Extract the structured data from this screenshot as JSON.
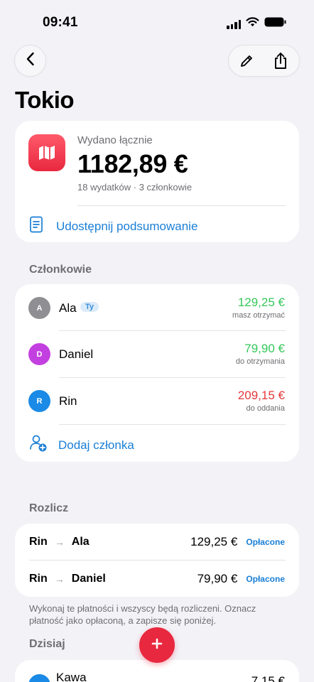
{
  "status_bar": {
    "time": "09:41"
  },
  "header": {
    "title": "Tokio"
  },
  "summary": {
    "label": "Wydano łącznie",
    "total": "1182,89 €",
    "meta": "18 wydatków · 3 członkowie",
    "share_label": "Udostępnij podsumowanie",
    "accent_color": "#e8283f"
  },
  "members": {
    "section_title": "Członkowie",
    "items": [
      {
        "initial": "A",
        "name": "Ala",
        "badge": "Ty",
        "amount": "129,25 €",
        "note": "masz otrzymać",
        "amount_color": "#34c759",
        "avatar_color": "#8e8e93"
      },
      {
        "initial": "D",
        "name": "Daniel",
        "amount": "79,90 €",
        "note": "do otrzymania",
        "amount_color": "#34c759",
        "avatar_color": "#c340e0"
      },
      {
        "initial": "R",
        "name": "Rin",
        "amount": "209,15 €",
        "note": "do oddania",
        "amount_color": "#e5383b",
        "avatar_color": "#1a8ae6"
      }
    ],
    "add_label": "Dodaj członka"
  },
  "settle": {
    "section_title": "Rozlicz",
    "items": [
      {
        "from": "Rin",
        "to": "Ala",
        "amount": "129,25 €",
        "action": "Opłacone"
      },
      {
        "from": "Rin",
        "to": "Daniel",
        "amount": "79,90 €",
        "action": "Opłacone"
      }
    ],
    "hint": "Wykonaj te płatności i wszyscy będą rozliczeni. Oznacz płatność jako opłaconą, a zapisze się poniżej."
  },
  "today": {
    "section_title": "Dzisiaj",
    "items": [
      {
        "name": "Kawa",
        "amount": "7,15 €"
      }
    ]
  },
  "colors": {
    "link": "#1a7fd6",
    "positive": "#34c759",
    "negative": "#e5383b",
    "background": "#f2f2f7"
  },
  "icons": [
    "chevron-left-icon",
    "pencil-icon",
    "share-icon",
    "map-icon",
    "document-icon",
    "add-person-icon",
    "plus-icon",
    "signal-icon",
    "wifi-icon",
    "battery-icon"
  ]
}
